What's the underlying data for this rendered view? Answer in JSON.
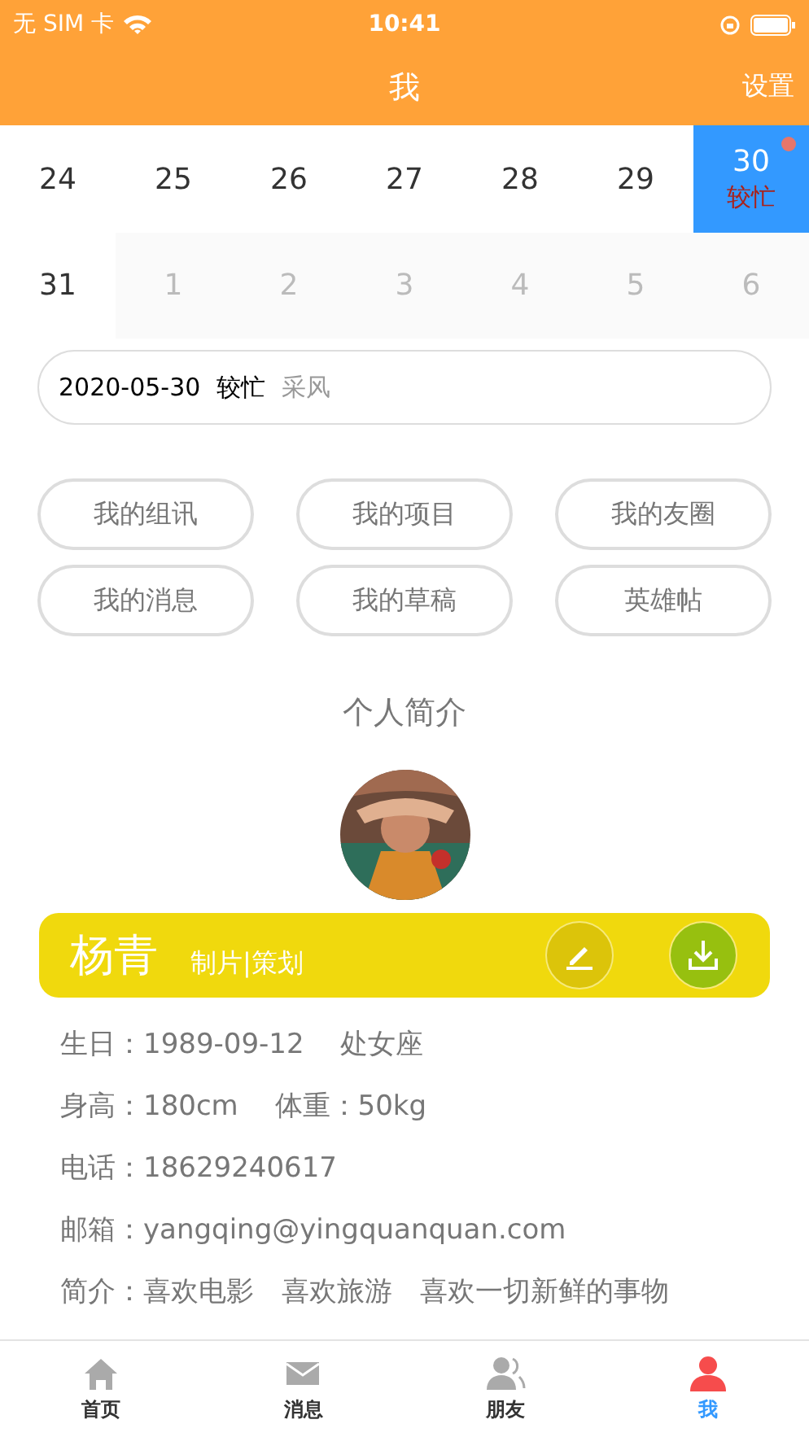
{
  "status_bar": {
    "carrier": "无 SIM 卡",
    "time": "10:41"
  },
  "nav": {
    "title": "我",
    "action": "设置"
  },
  "calendar": {
    "days": [
      {
        "label": "24",
        "in_month": true,
        "selected": false
      },
      {
        "label": "25",
        "in_month": true,
        "selected": false
      },
      {
        "label": "26",
        "in_month": true,
        "selected": false
      },
      {
        "label": "27",
        "in_month": true,
        "selected": false
      },
      {
        "label": "28",
        "in_month": true,
        "selected": false
      },
      {
        "label": "29",
        "in_month": true,
        "selected": false
      },
      {
        "label": "30",
        "in_month": true,
        "selected": true,
        "status": "较忙",
        "dot": true
      },
      {
        "label": "31",
        "in_month": true,
        "selected": false
      },
      {
        "label": "1",
        "in_month": false,
        "selected": false
      },
      {
        "label": "2",
        "in_month": false,
        "selected": false
      },
      {
        "label": "3",
        "in_month": false,
        "selected": false
      },
      {
        "label": "4",
        "in_month": false,
        "selected": false
      },
      {
        "label": "5",
        "in_month": false,
        "selected": false
      },
      {
        "label": "6",
        "in_month": false,
        "selected": false
      }
    ]
  },
  "schedule": {
    "date": "2020-05-30",
    "status": "较忙",
    "note": "采风"
  },
  "shortcuts": [
    "我的组讯",
    "我的项目",
    "我的友圈",
    "我的消息",
    "我的草稿",
    "英雄帖"
  ],
  "section_title": "个人简介",
  "profile": {
    "name": "杨青",
    "role": "制片|策划"
  },
  "info_lines": [
    "生日：1989-09-12　 处女座",
    "身高：180cm　 体重：50kg",
    "电话：18629240617",
    "邮箱：yangqing@yingquanquan.com",
    "简介：喜欢电影　喜欢旅游　喜欢一切新鲜的事物"
  ],
  "tabs": [
    {
      "label": "首页",
      "kind": "home",
      "selected": false
    },
    {
      "label": "消息",
      "kind": "mail",
      "selected": false
    },
    {
      "label": "朋友",
      "kind": "friends",
      "selected": false
    },
    {
      "label": "我",
      "kind": "me",
      "selected": true
    }
  ]
}
